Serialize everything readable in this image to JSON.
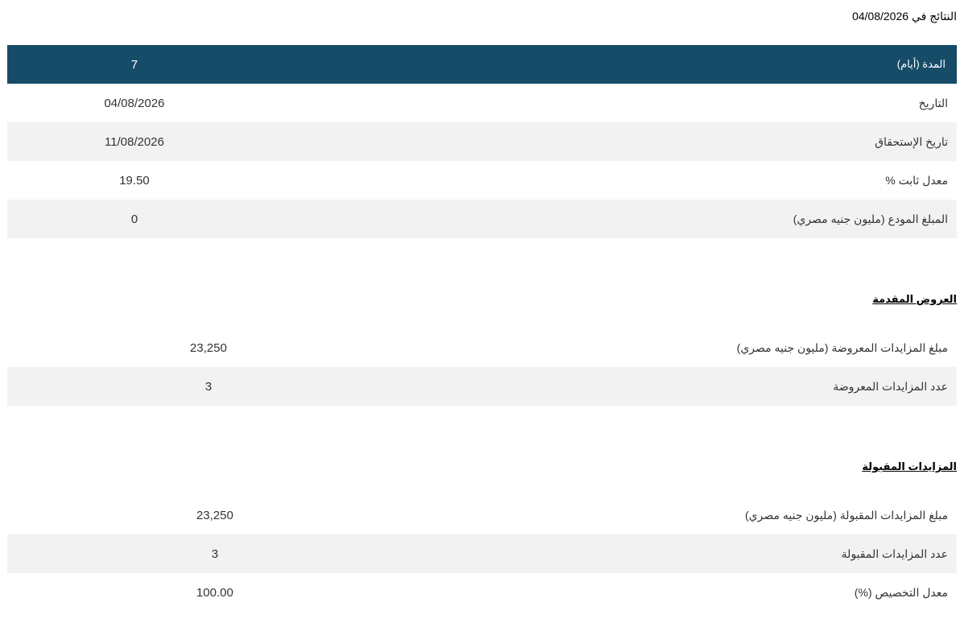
{
  "results": {
    "prefix": "النتائج في",
    "date": "04/08/2026"
  },
  "summary": {
    "header": {
      "label": "المدة (أيام)",
      "value": "7"
    },
    "rows": [
      {
        "label": "التاريخ",
        "value": "04/08/2026"
      },
      {
        "label": "تاريخ الإستحقاق",
        "value": "11/08/2026"
      },
      {
        "label": "معدل ثابت %",
        "value": "19.50"
      },
      {
        "label": "المبلغ المودع (مليون جنيه مصري)",
        "value": "0"
      }
    ]
  },
  "offered": {
    "title": "العروض المقدمة",
    "rows": [
      {
        "label": "مبلغ المزايدات المعروضة (مليون جنيه مصري)",
        "value": "23,250"
      },
      {
        "label": "عدد المزايدات المعروضة",
        "value": "3"
      }
    ]
  },
  "accepted": {
    "title": "المزايدات المقبولة",
    "rows": [
      {
        "label": "مبلغ المزايدات المقبولة (مليون جنيه مصري)",
        "value": "23,250"
      },
      {
        "label": "عدد المزايدات المقبولة",
        "value": "3"
      },
      {
        "label": "معدل التخصيص (%)",
        "value": "100.00"
      }
    ]
  },
  "colors": {
    "header_bg": "#174c68",
    "stripe_bg": "#f2f2f2"
  }
}
